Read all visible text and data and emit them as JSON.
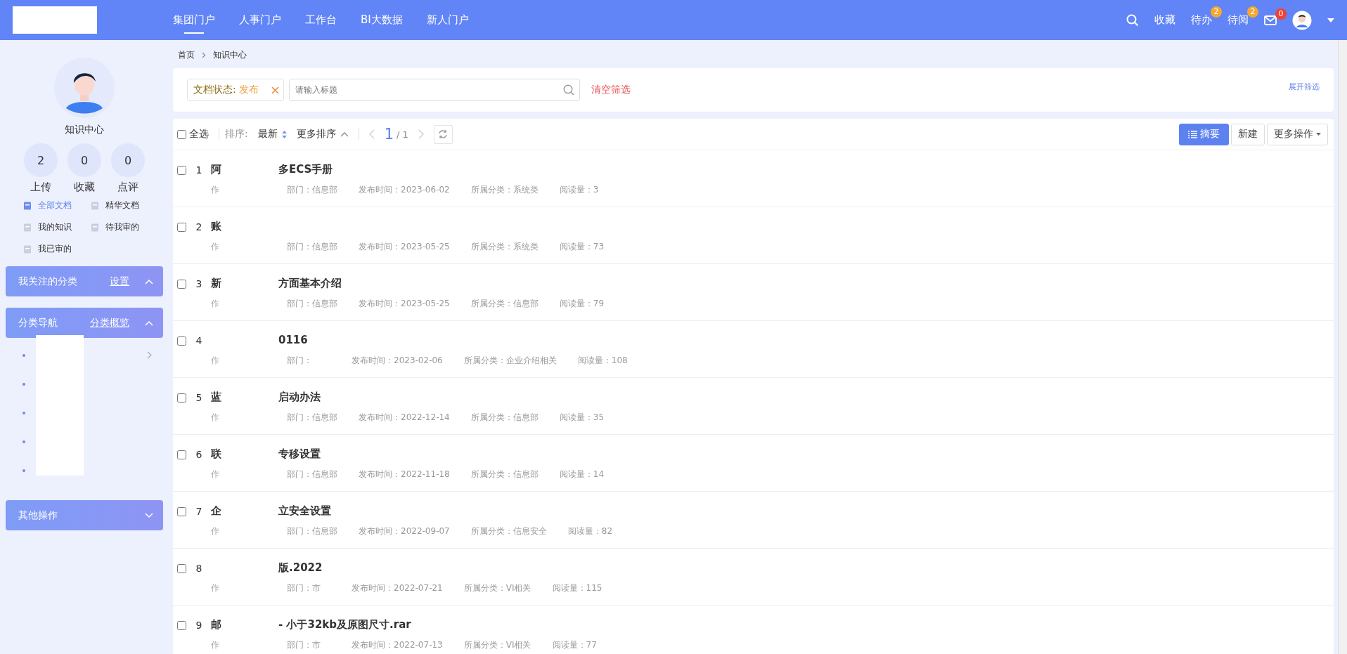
{
  "top_nav": {
    "tabs": [
      {
        "label": "集团门户",
        "selected": true
      },
      {
        "label": "人事门户",
        "selected": false
      },
      {
        "label": "工作台",
        "selected": false
      },
      {
        "label": "BI大数据",
        "selected": false
      },
      {
        "label": "新人门户",
        "selected": false
      }
    ],
    "favorites": "收藏",
    "todo": {
      "label": "待办",
      "count": "2"
    },
    "toread": {
      "label": "待阅",
      "count": "2"
    },
    "mail_count": "0"
  },
  "sidebar": {
    "title": "知识中心",
    "stats": [
      {
        "value": "2",
        "label": "上传"
      },
      {
        "value": "0",
        "label": "收藏"
      },
      {
        "value": "0",
        "label": "点评"
      }
    ],
    "links": [
      {
        "label": "全部文档",
        "selected": true
      },
      {
        "label": "精华文档",
        "selected": false
      },
      {
        "label": "我的知识",
        "selected": false
      },
      {
        "label": "待我审的",
        "selected": false
      },
      {
        "label": "我已审的",
        "selected": false
      }
    ],
    "panels": [
      {
        "title": "我关注的分类",
        "action": "设置",
        "expanded": true
      },
      {
        "title": "分类导航",
        "action": "分类概览",
        "expanded": true
      },
      {
        "title": "其他操作",
        "expanded": false
      }
    ]
  },
  "breadcrumb": [
    "首页",
    "知识中心"
  ],
  "filter": {
    "tag_label": "文档状态:",
    "tag_value": "发布",
    "search_placeholder": "请输入标题",
    "clear": "清空筛选",
    "expand": "展开筛选"
  },
  "toolbar": {
    "select_all": "全选",
    "select_all_checked": false,
    "sort_label": "排序:",
    "sort_newest": "最新",
    "more_sort": "更多排序",
    "page": "1",
    "total": "/ 1",
    "summary": "摘要",
    "new": "新建",
    "more_actions": "更多操作"
  },
  "rows": [
    {
      "checked": false,
      "index": "1",
      "title_start": "阿",
      "title_end": "多ECS手册",
      "author": "作",
      "dept": "部门：信息部",
      "date": "发布时间：2023-06-02",
      "category": "所属分类：系统类",
      "reads": "阅读量：3"
    },
    {
      "checked": false,
      "index": "2",
      "title_start": "账",
      "author": "作",
      "dept": "部门：信息部",
      "date": "发布时间：2023-05-25",
      "category": "所属分类：系统类",
      "reads": "阅读量：73"
    },
    {
      "checked": false,
      "index": "3",
      "title_start": "新",
      "title_end": "方面基本介绍",
      "author": "作",
      "dept": "部门：信息部",
      "date": "发布时间：2023-05-25",
      "category": "所属分类：信息部",
      "reads": "阅读量：79"
    },
    {
      "checked": false,
      "index": "4",
      "title_end": "0116",
      "author": "作",
      "dept": "部门：",
      "date": "发布时间：2023-02-06",
      "category": "所属分类：企业介绍相关",
      "reads": "阅读量：108"
    },
    {
      "checked": false,
      "index": "5",
      "title_start": "蓝",
      "title_end": "启动办法",
      "author": "作",
      "dept": "部门：信息部",
      "date": "发布时间：2022-12-14",
      "category": "所属分类：信息部",
      "reads": "阅读量：35"
    },
    {
      "checked": false,
      "index": "6",
      "title_start": "联",
      "title_end": "专移设置",
      "author": "作",
      "dept": "部门：信息部",
      "date": "发布时间：2022-11-18",
      "category": "所属分类：信息部",
      "reads": "阅读量：14"
    },
    {
      "checked": false,
      "index": "7",
      "title_start": "企",
      "title_end": "立安全设置",
      "author": "作",
      "dept": "部门：信息部",
      "date": "发布时间：2022-09-07",
      "category": "所属分类：信息安全",
      "reads": "阅读量：82"
    },
    {
      "checked": false,
      "index": "8",
      "title_end": "版.2022",
      "author": "作",
      "dept": "部门：市",
      "date": "发布时间：2022-07-21",
      "category": "所属分类：VI相关",
      "reads": "阅读量：115"
    },
    {
      "checked": false,
      "index": "9",
      "title_start": "邮",
      "title_end": "- 小于32kb及原图尺寸.rar",
      "author": "作",
      "dept": "部门：市",
      "date": "发布时间：2022-07-13",
      "category": "所属分类：VI相关",
      "reads": "阅读量：77"
    }
  ]
}
